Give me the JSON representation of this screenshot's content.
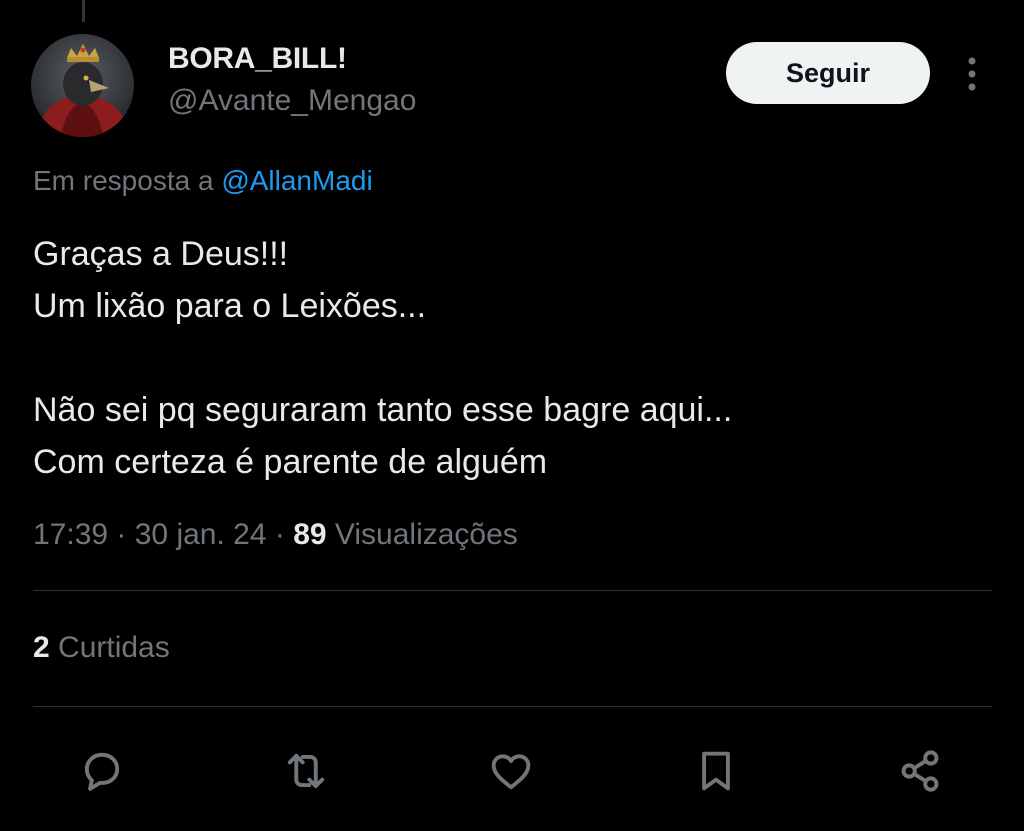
{
  "tweet": {
    "display_name": "BORA_BILL!",
    "handle": "@Avante_Mengao",
    "follow_label": "Seguir",
    "reply_prefix": "Em resposta a ",
    "reply_to": "@AllanMadi",
    "text_lines": [
      "Graças a Deus!!!",
      "Um lixão para o Leixões...",
      "",
      "Não sei pq seguraram tanto esse bagre aqui...",
      "Com certeza é parente de alguém"
    ],
    "time": "17:39",
    "separator": " · ",
    "date": "30 jan. 24",
    "views_count": "89",
    "views_label": " Visualizações",
    "likes_count": "2",
    "likes_label": " Curtidas"
  },
  "actions": [
    {
      "name": "reply",
      "icon": "comment-icon"
    },
    {
      "name": "retweet",
      "icon": "retweet-icon"
    },
    {
      "name": "like",
      "icon": "heart-icon"
    },
    {
      "name": "bookmark",
      "icon": "bookmark-icon"
    },
    {
      "name": "share",
      "icon": "share-icon"
    }
  ],
  "colors": {
    "background": "#000000",
    "primary_text": "#e7e9ea",
    "secondary_text": "#71767b",
    "link": "#1d9bf0",
    "divider": "#2f3336",
    "follow_button_bg": "#eff3f4"
  }
}
